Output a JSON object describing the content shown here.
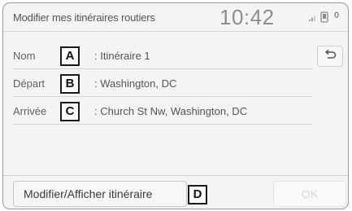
{
  "header": {
    "title": "Modifier mes itinéraires routiers",
    "clock": "10:42",
    "icons": [
      "signal-icon",
      "phone-icon",
      "sms-icon"
    ],
    "sms_glyph": "0"
  },
  "rows": [
    {
      "label": "Nom",
      "callout": "A",
      "value": ": Itinéraire 1"
    },
    {
      "label": "Départ",
      "callout": "B",
      "value": ": Washington, DC"
    },
    {
      "label": "Arrivée",
      "callout": "C",
      "value": ": Church St Nw, Washington, DC"
    }
  ],
  "back_button": {
    "icon": "back-arrow-icon"
  },
  "footer": {
    "modify_label": "Modifier/Afficher itinéraire",
    "modify_callout": "D",
    "ok_label": "OK",
    "ok_enabled": false
  }
}
